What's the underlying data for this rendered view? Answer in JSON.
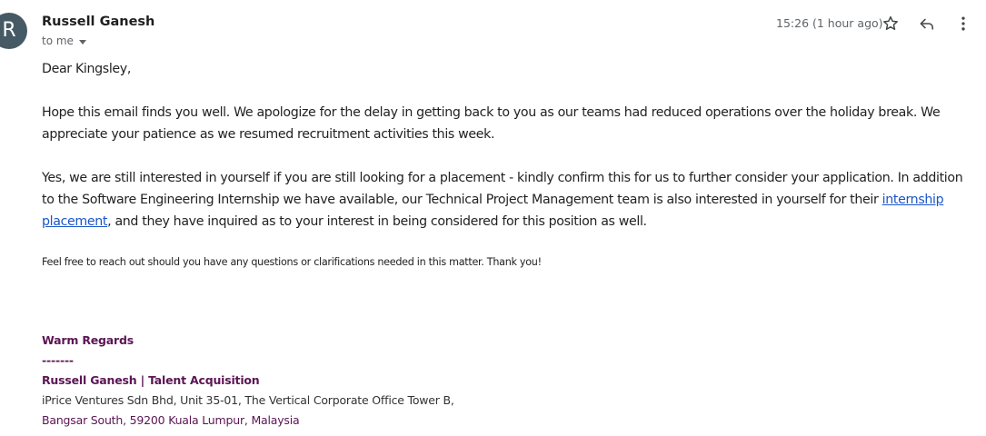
{
  "header": {
    "avatar_letter": "R",
    "sender_name": "Russell Ganesh",
    "recipient_label": "to me",
    "timestamp": "15:26 (1 hour ago)",
    "icons": [
      "star-icon",
      "reply-icon",
      "more-vert-icon"
    ]
  },
  "body": {
    "greeting": "Dear Kingsley,",
    "paragraph1": "Hope this email finds you well. We apologize for the delay in getting back to you as our teams had reduced operations over the holiday break. We appreciate your patience as we resumed recruitment activities this week.",
    "paragraph2_before_link": "Yes, we are still interested in yourself if you are still looking for a placement - kindly confirm this for us to further consider your application. In addition to the Software Engineering Internship we have available, our Technical Project Management team is also interested in yourself for their ",
    "paragraph2_link": "internship placement",
    "paragraph2_after_link": ", and they have inquired as to your interest in being considered for this position as well.",
    "paragraph3": "Feel free to reach out should you have any questions or clarifications needed in this matter. Thank you!"
  },
  "signature": {
    "closing": "Warm Regards",
    "divider": "-------",
    "name_title": "Russell Ganesh | Talent Acquisition",
    "address_line1": "iPrice Ventures Sdn Bhd, Unit 35-01, The Vertical Corporate Office Tower B,",
    "address_line2": "Bangsar South, 59200 Kuala Lumpur, Malaysia"
  },
  "colors": {
    "avatar_bg": "#455a64",
    "link": "#1a55c9",
    "signature_purple": "#5b1554",
    "muted": "#5f6368"
  }
}
